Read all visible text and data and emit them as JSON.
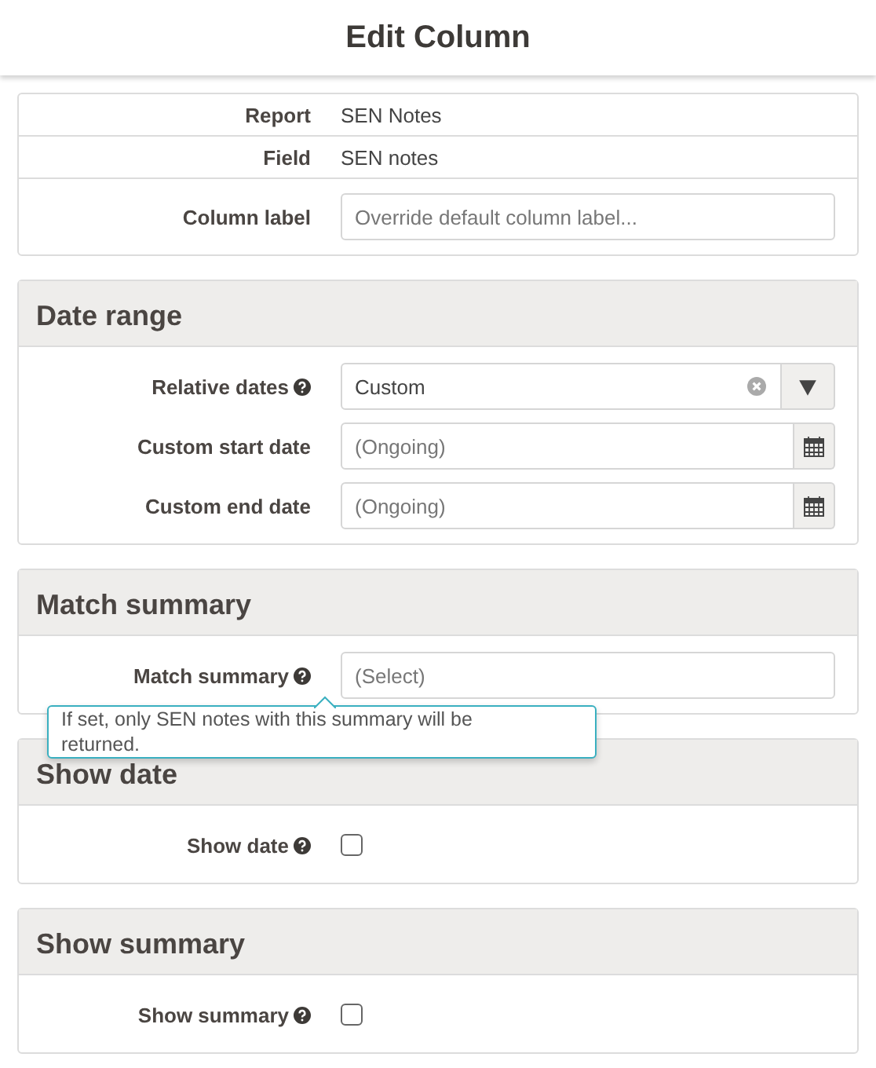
{
  "title": "Edit Column",
  "sections": [
    {
      "kind": "table",
      "rows": [
        {
          "kind": "text",
          "label": "Report",
          "value": "SEN Notes"
        },
        {
          "kind": "text",
          "label": "Field",
          "value": "SEN notes"
        },
        {
          "kind": "input",
          "label": "Column label",
          "placeholder": "Override default column label..."
        }
      ]
    },
    {
      "kind": "form",
      "heading": "Date range",
      "rows": [
        {
          "kind": "select",
          "label": "Relative dates",
          "help": true,
          "value": "Custom"
        },
        {
          "kind": "date",
          "label": "Custom start date",
          "help": false,
          "placeholder": "(Ongoing)"
        },
        {
          "kind": "date",
          "label": "Custom end date",
          "help": false,
          "placeholder": "(Ongoing)"
        }
      ]
    },
    {
      "kind": "form",
      "heading": "Match summary",
      "rows": [
        {
          "kind": "input",
          "label": "Match summary",
          "help": true,
          "placeholder": "(Select)",
          "tooltip": "If set, only SEN notes with this summary will be returned."
        }
      ]
    },
    {
      "kind": "form",
      "heading": "Show date",
      "rows": [
        {
          "kind": "checkbox",
          "label": "Show date",
          "help": true,
          "checked": false
        }
      ]
    },
    {
      "kind": "form",
      "heading": "Show summary",
      "rows": [
        {
          "kind": "checkbox",
          "label": "Show summary",
          "help": true,
          "checked": false
        }
      ]
    }
  ]
}
